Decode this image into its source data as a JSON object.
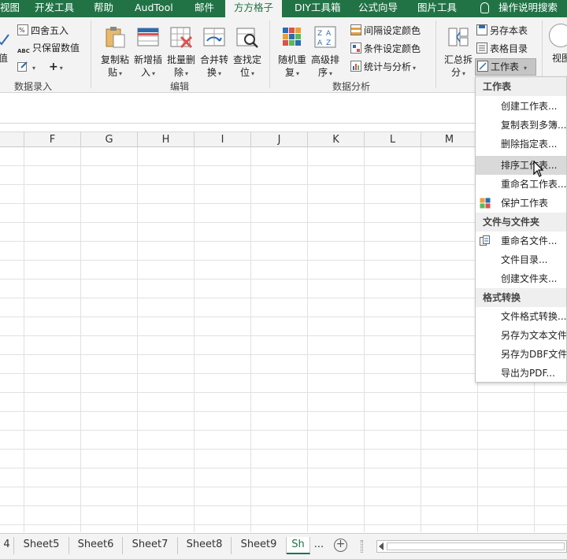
{
  "ribbon_tabs": [
    "视图",
    "开发工具",
    "帮助",
    "AudTool",
    "邮件",
    "方方格子",
    "DIY工具箱",
    "公式向导",
    "图片工具",
    "操作说明搜索"
  ],
  "active_tab": "方方格子",
  "group_data_entry": {
    "label": "数据录入",
    "big_button_fragment": "值",
    "round_label": "四舍五入",
    "keep_values_label": "只保留数值",
    "abc_text": "ABC",
    "plus_text": "+"
  },
  "group_edit": {
    "label": "编辑",
    "buttons": [
      {
        "line1": "复制粘",
        "line2": "贴"
      },
      {
        "line1": "新增插",
        "line2": "入"
      },
      {
        "line1": "批量删",
        "line2": "除"
      },
      {
        "line1": "合并转",
        "line2": "换"
      },
      {
        "line1": "查找定",
        "line2": "位"
      }
    ]
  },
  "group_analysis": {
    "label": "数据分析",
    "buttons": [
      {
        "line1": "随机重",
        "line2": "复"
      },
      {
        "line1": "高级排",
        "line2": "序"
      }
    ],
    "small_buttons": [
      "间隔设定颜色",
      "条件设定颜色",
      "统计与分析"
    ]
  },
  "group_workbook": {
    "summary_line1": "汇总拆",
    "summary_line2": "分",
    "small_buttons": [
      "另存本表",
      "表格目录",
      "工作表"
    ]
  },
  "group_view": {
    "label": "视图"
  },
  "column_headers": [
    "F",
    "G",
    "H",
    "I",
    "J",
    "K",
    "L",
    "M"
  ],
  "sheet_tabs": [
    "4",
    "Sheet5",
    "Sheet6",
    "Sheet7",
    "Sheet8",
    "Sheet9",
    "Sh"
  ],
  "sheet_more": "...",
  "active_sheet": "Sh",
  "menu": {
    "sections": [
      {
        "title": "工作表",
        "items": [
          {
            "label": "创建工作表...",
            "icon": ""
          },
          {
            "label": "复制表到多簿...",
            "icon": ""
          },
          {
            "label": "删除指定表...",
            "icon": ""
          },
          {
            "label": "排序工作表...",
            "icon": "",
            "hover": true
          },
          {
            "label": "重命名工作表...",
            "icon": ""
          },
          {
            "label": "保护工作表",
            "icon": "shield-icon"
          }
        ]
      },
      {
        "title": "文件与文件夹",
        "items": [
          {
            "label": "重命名文件...",
            "icon": "file-rename-icon"
          },
          {
            "label": "文件目录...",
            "icon": ""
          },
          {
            "label": "创建文件夹...",
            "icon": ""
          }
        ]
      },
      {
        "title": "格式转换",
        "items": [
          {
            "label": "文件格式转换...",
            "icon": ""
          },
          {
            "label": "另存为文本文件",
            "icon": ""
          },
          {
            "label": "另存为DBF文件",
            "icon": ""
          },
          {
            "label": "导出为PDF...",
            "icon": ""
          }
        ]
      }
    ]
  },
  "colors": {
    "excel_green": "#217346",
    "ribbon_bg": "#f3f3f3",
    "menu_hover": "#d9d9d9"
  }
}
